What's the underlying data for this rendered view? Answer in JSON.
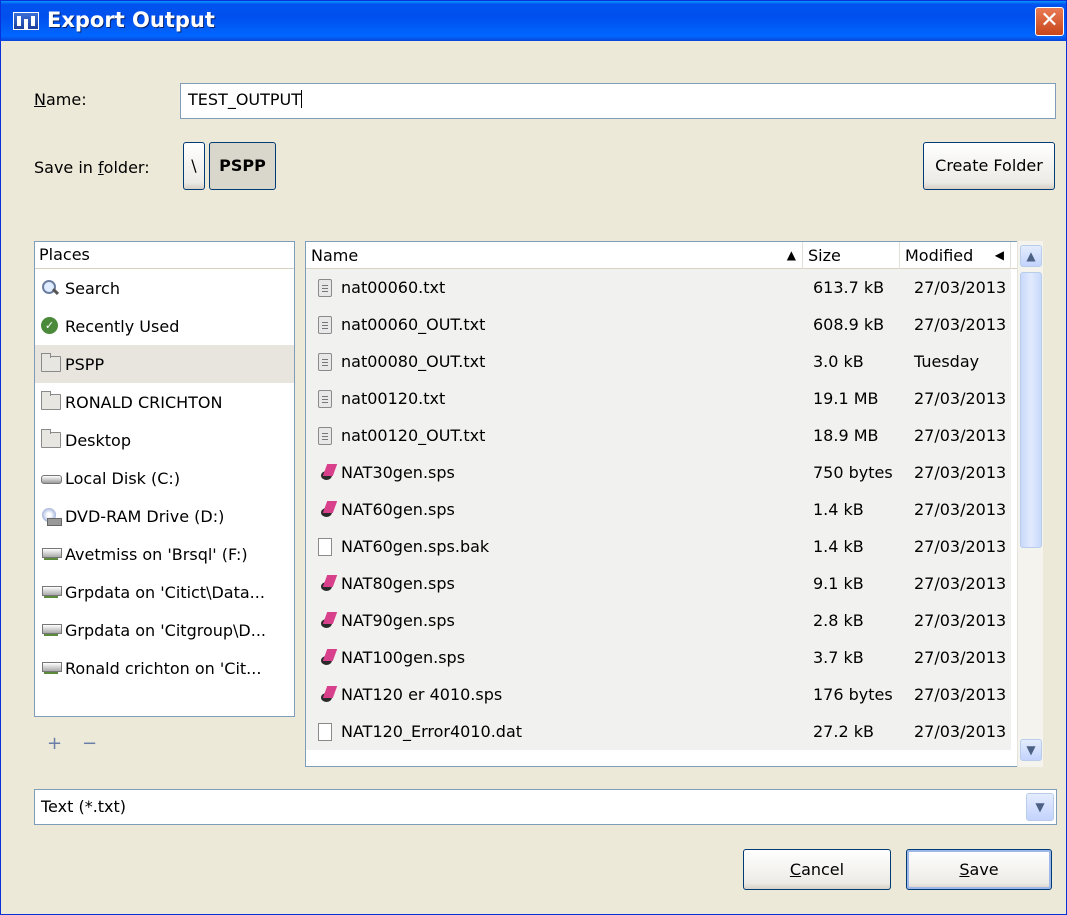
{
  "window": {
    "title": "Export Output",
    "close_glyph": "✕"
  },
  "name_field": {
    "label_pre": "",
    "label_mnemonic": "N",
    "label_post": "ame:",
    "value": "TEST_OUTPUT"
  },
  "folder": {
    "label_pre": "Save in ",
    "label_mnemonic": "f",
    "label_post": "older:",
    "path": [
      "\\",
      "PSPP"
    ]
  },
  "create_folder_label": "Create Folder",
  "places": {
    "header": "Places",
    "items": [
      {
        "label": "Search",
        "icon": "search-icon"
      },
      {
        "label": "Recently Used",
        "icon": "recent-icon"
      },
      {
        "label": "PSPP",
        "icon": "folder-icon",
        "selected": true
      },
      {
        "label": "RONALD CRICHTON",
        "icon": "folder-icon"
      },
      {
        "label": "Desktop",
        "icon": "folder-icon"
      },
      {
        "label": "Local Disk (C:)",
        "icon": "disk-icon"
      },
      {
        "label": "DVD-RAM Drive (D:)",
        "icon": "dvd-icon"
      },
      {
        "label": "Avetmiss on 'Brsql' (F:)",
        "icon": "network-drive-icon"
      },
      {
        "label": "Grpdata on 'Citict\\Data...",
        "icon": "network-drive-icon"
      },
      {
        "label": "Grpdata on 'Citgroup\\D...",
        "icon": "network-drive-icon"
      },
      {
        "label": "Ronald crichton on 'Cit...",
        "icon": "network-drive-icon"
      }
    ],
    "add_glyph": "+",
    "remove_glyph": "−"
  },
  "files": {
    "columns": {
      "name": "Name",
      "size": "Size",
      "modified": "Modified"
    },
    "sort_indicator": "▲",
    "column_arrow": "◀",
    "rows": [
      {
        "name": "nat00060.txt",
        "size": "613.7 kB",
        "modified": "27/03/2013",
        "type": "text"
      },
      {
        "name": "nat00060_OUT.txt",
        "size": "608.9 kB",
        "modified": "27/03/2013",
        "type": "text"
      },
      {
        "name": "nat00080_OUT.txt",
        "size": "3.0 kB",
        "modified": "Tuesday",
        "type": "text"
      },
      {
        "name": "nat00120.txt",
        "size": "19.1 MB",
        "modified": "27/03/2013",
        "type": "text"
      },
      {
        "name": "nat00120_OUT.txt",
        "size": "18.9 MB",
        "modified": "27/03/2013",
        "type": "text"
      },
      {
        "name": "NAT30gen.sps",
        "size": "750 bytes",
        "modified": "27/03/2013",
        "type": "sps"
      },
      {
        "name": "NAT60gen.sps",
        "size": "1.4 kB",
        "modified": "27/03/2013",
        "type": "sps"
      },
      {
        "name": "NAT60gen.sps.bak",
        "size": "1.4 kB",
        "modified": "27/03/2013",
        "type": "blank"
      },
      {
        "name": "NAT80gen.sps",
        "size": "9.1 kB",
        "modified": "27/03/2013",
        "type": "sps"
      },
      {
        "name": "NAT90gen.sps",
        "size": "2.8 kB",
        "modified": "27/03/2013",
        "type": "sps"
      },
      {
        "name": "NAT100gen.sps",
        "size": "3.7 kB",
        "modified": "27/03/2013",
        "type": "sps"
      },
      {
        "name": "NAT120 er 4010.sps",
        "size": "176 bytes",
        "modified": "27/03/2013",
        "type": "sps"
      },
      {
        "name": "NAT120_Error4010.dat",
        "size": "27.2 kB",
        "modified": "27/03/2013",
        "type": "blank"
      }
    ],
    "scroll_up_glyph": "▲",
    "scroll_down_glyph": "▼"
  },
  "filter": {
    "value": "Text (*.txt)",
    "dropdown_glyph": "▼"
  },
  "buttons": {
    "cancel": {
      "mnemonic": "C",
      "rest": "ancel"
    },
    "save": {
      "mnemonic": "S",
      "rest": "ave"
    }
  }
}
